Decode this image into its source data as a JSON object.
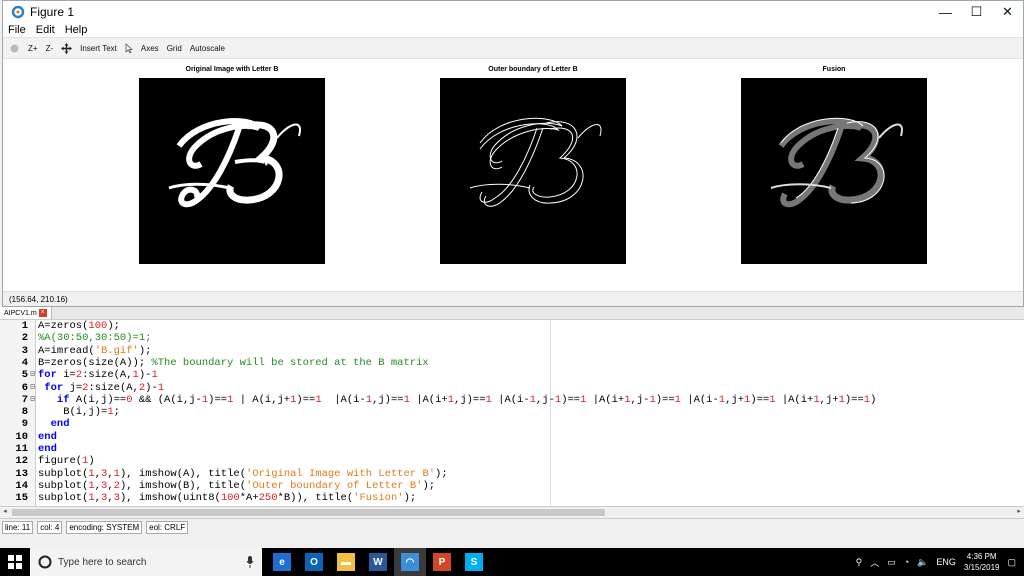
{
  "figure_window": {
    "title": "Figure 1",
    "controls": {
      "minimize": "—",
      "maximize": "☐",
      "close": "✕"
    }
  },
  "menu": [
    "File",
    "Edit",
    "Help"
  ],
  "toolbar": {
    "zoom_in": "Z+",
    "zoom_out": "Z-",
    "insert_text": "Insert Text",
    "axes": "Axes",
    "grid": "Grid",
    "autoscale": "Autoscale"
  },
  "panels": [
    {
      "title": "Original Image with Letter B",
      "style": "filled"
    },
    {
      "title": "Outer boundary of Letter B",
      "style": "outline"
    },
    {
      "title": "Fusion",
      "style": "fusion"
    }
  ],
  "coords": "(156.64, 210.16)",
  "editor": {
    "tab_name": "AIPCV1.m",
    "lines": [
      {
        "n": "1",
        "fold": "",
        "html": "A=zeros(<span class=\"nm\">100</span>);"
      },
      {
        "n": "2",
        "fold": "",
        "html": "<span class=\"cm\">%A(30:50,30:50)=1;</span>"
      },
      {
        "n": "3",
        "fold": "",
        "html": "A=imread(<span class=\"st\">'B.gif'</span>);"
      },
      {
        "n": "4",
        "fold": "",
        "html": "B=zeros(size(A)); <span class=\"cm\">%The boundary will be stored at the B matrix</span>"
      },
      {
        "n": "5",
        "fold": "⊟",
        "html": "<span class=\"kw\">for</span> i=<span class=\"nm\">2</span>:size(A,<span class=\"nm\">1</span>)-<span class=\"nm\">1</span>"
      },
      {
        "n": "6",
        "fold": "⊟",
        "html": " <span class=\"kw\">for</span> j=<span class=\"nm\">2</span>:size(A,<span class=\"nm\">2</span>)-<span class=\"nm\">1</span>"
      },
      {
        "n": "7",
        "fold": "⊟",
        "html": "   <span class=\"kw\">if</span> A(i,j)==<span class=\"nm\">0</span> &amp;&amp; (A(i,j-<span class=\"nm\">1</span>)==<span class=\"nm\">1</span> | A(i,j+<span class=\"nm\">1</span>)==<span class=\"nm\">1</span>  |A(i-<span class=\"nm\">1</span>,j)==<span class=\"nm\">1</span> |A(i+<span class=\"nm\">1</span>,j)==<span class=\"nm\">1</span> |A(i-<span class=\"nm\">1</span>,j-<span class=\"nm\">1</span>)==<span class=\"nm\">1</span> |A(i+<span class=\"nm\">1</span>,j-<span class=\"nm\">1</span>)==<span class=\"nm\">1</span> |A(i-<span class=\"nm\">1</span>,j+<span class=\"nm\">1</span>)==<span class=\"nm\">1</span> |A(i+<span class=\"nm\">1</span>,j+<span class=\"nm\">1</span>)==<span class=\"nm\">1</span>)"
      },
      {
        "n": "8",
        "fold": "",
        "html": "    B(i,j)=<span class=\"nm\">1</span>;"
      },
      {
        "n": "9",
        "fold": "",
        "html": "  <span class=\"kw\">end</span>"
      },
      {
        "n": "10",
        "fold": "",
        "html": "<span class=\"kw\">end</span>"
      },
      {
        "n": "11",
        "fold": "",
        "html": "<span class=\"kw\">end</span>"
      },
      {
        "n": "12",
        "fold": "",
        "html": "figure(<span class=\"nm\">1</span>)"
      },
      {
        "n": "13",
        "fold": "",
        "html": "subplot(<span class=\"nm\">1</span>,<span class=\"nm\">3</span>,<span class=\"nm\">1</span>), imshow(A), title(<span class=\"st\">'Original Image with Letter B'</span>);"
      },
      {
        "n": "14",
        "fold": "",
        "html": "subplot(<span class=\"nm\">1</span>,<span class=\"nm\">3</span>,<span class=\"nm\">2</span>), imshow(B), title(<span class=\"st\">'Outer boundary of Letter B'</span>);"
      },
      {
        "n": "15",
        "fold": "",
        "html": "subplot(<span class=\"nm\">1</span>,<span class=\"nm\">3</span>,<span class=\"nm\">3</span>), imshow(uint8(<span class=\"nm\">100</span>*A+<span class=\"nm\">250</span>*B)), title(<span class=\"st\">'Fusion'</span>);"
      }
    ]
  },
  "status": {
    "line": "line: 11",
    "col": "col: 4",
    "encoding": "encoding: SYSTEM",
    "eol": "eol: CRLF"
  },
  "taskbar": {
    "search_placeholder": "Type here to search",
    "apps": [
      {
        "name": "edge",
        "label": "e",
        "color": "#1e6fd1"
      },
      {
        "name": "outlook",
        "label": "O",
        "color": "#0a64b8"
      },
      {
        "name": "explorer",
        "label": "▬",
        "color": "#f2c040"
      },
      {
        "name": "word",
        "label": "W",
        "color": "#2b579a"
      },
      {
        "name": "octave",
        "label": "◠",
        "color": "#3c8ed9"
      },
      {
        "name": "powerpoint",
        "label": "P",
        "color": "#d24726"
      },
      {
        "name": "skype",
        "label": "S",
        "color": "#00aff0"
      }
    ],
    "language": "ENG",
    "time": "4:36 PM",
    "date": "3/15/2019"
  }
}
